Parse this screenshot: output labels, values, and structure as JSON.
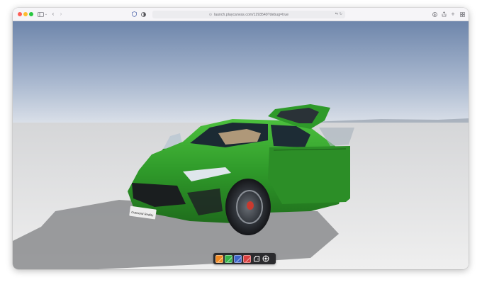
{
  "browser": {
    "url": "launch.playcanvas.com/1293549?debug=true",
    "traffic_lights": [
      "#fe5f57",
      "#febc2e",
      "#28c840"
    ]
  },
  "icons": {
    "sidebar": "sidebar-icon",
    "back": "chevron-left-icon",
    "forward": "chevron-right-icon",
    "shield": "shield-icon",
    "contrast": "contrast-icon",
    "translate": "translate-icon",
    "reload": "reload-icon",
    "download": "download-icon",
    "share": "share-icon",
    "new_tab": "plus-icon",
    "tabs": "tab-overview-icon"
  },
  "scene": {
    "license_plate": "Outmend Reality",
    "car_color": "#2f9a2a",
    "sky_color": "#7e95b8"
  },
  "paint_toolbar": {
    "swatches": [
      {
        "name": "orange",
        "color": "#f08a24"
      },
      {
        "name": "green",
        "color": "#36b34a"
      },
      {
        "name": "blue",
        "color": "#3f66c8"
      },
      {
        "name": "red",
        "color": "#d94141"
      }
    ],
    "door_icon": "car-door-icon",
    "wheel_icon": "wheel-icon"
  }
}
